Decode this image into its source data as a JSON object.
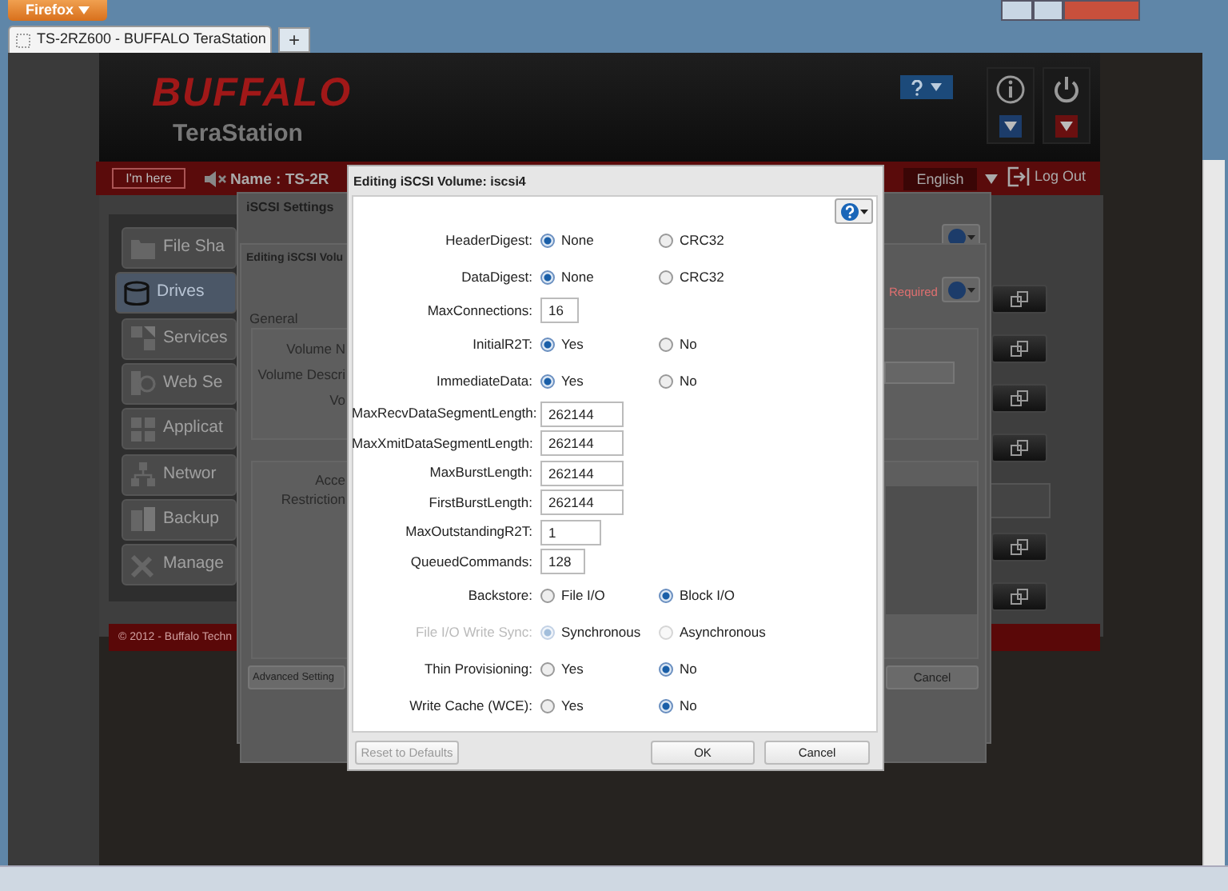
{
  "browser": {
    "menu_button": "Firefox",
    "tab_title": "TS-2RZ600 - BUFFALO TeraStation",
    "new_tab": "+"
  },
  "header": {
    "logo": "BUFFALO",
    "product": "TeraStation"
  },
  "toolbar": {
    "locate_button": "I'm here",
    "device_name": "Name : TS-2R",
    "language": "English",
    "logout": "Log Out"
  },
  "sidebar": {
    "items": [
      {
        "label": "File Sha",
        "selected": false
      },
      {
        "label": "Drives",
        "selected": true
      },
      {
        "label": "Services",
        "selected": false
      },
      {
        "label": "Web Se",
        "selected": false
      },
      {
        "label": "Applicat",
        "selected": false
      },
      {
        "label": "Networ",
        "selected": false
      },
      {
        "label": "Backup",
        "selected": false
      },
      {
        "label": "Manage",
        "selected": false
      }
    ]
  },
  "footer": "© 2012 - Buffalo Techn",
  "settings_dialog": {
    "title": "iSCSI Settings"
  },
  "volume_dialog": {
    "title": "Editing iSCSI Volu",
    "required": "Required",
    "section": "General",
    "general_labels": [
      "Volume N",
      "Volume Descri",
      "Vo"
    ],
    "access_labels": [
      "Acce",
      "Restriction"
    ],
    "advanced_button": "Advanced Setting",
    "cancel_button": "Cancel"
  },
  "edit_dialog": {
    "title": "Editing iSCSI Volume: iscsi4",
    "fields": [
      {
        "kind": "radio",
        "label": "HeaderDigest:",
        "disabled": false,
        "options": [
          {
            "label": "None",
            "selected": true
          },
          {
            "label": "CRC32",
            "selected": false
          }
        ]
      },
      {
        "kind": "radio",
        "label": "DataDigest:",
        "disabled": false,
        "options": [
          {
            "label": "None",
            "selected": true
          },
          {
            "label": "CRC32",
            "selected": false
          }
        ]
      },
      {
        "kind": "text",
        "label": "MaxConnections:",
        "value": "16"
      },
      {
        "kind": "radio",
        "label": "InitialR2T:",
        "disabled": false,
        "options": [
          {
            "label": "Yes",
            "selected": true
          },
          {
            "label": "No",
            "selected": false
          }
        ]
      },
      {
        "kind": "radio",
        "label": "ImmediateData:",
        "disabled": false,
        "options": [
          {
            "label": "Yes",
            "selected": true
          },
          {
            "label": "No",
            "selected": false
          }
        ]
      },
      {
        "kind": "text",
        "label": "MaxRecvDataSegmentLength:",
        "value": "262144"
      },
      {
        "kind": "text",
        "label": "MaxXmitDataSegmentLength:",
        "value": "262144"
      },
      {
        "kind": "text",
        "label": "MaxBurstLength:",
        "value": "262144"
      },
      {
        "kind": "text",
        "label": "FirstBurstLength:",
        "value": "262144"
      },
      {
        "kind": "text",
        "label": "MaxOutstandingR2T:",
        "value": "1"
      },
      {
        "kind": "text",
        "label": "QueuedCommands:",
        "value": "128"
      },
      {
        "kind": "radio",
        "label": "Backstore:",
        "disabled": false,
        "options": [
          {
            "label": "File I/O",
            "selected": false
          },
          {
            "label": "Block I/O",
            "selected": true
          }
        ]
      },
      {
        "kind": "radio",
        "label": "File I/O Write Sync:",
        "disabled": true,
        "options": [
          {
            "label": "Synchronous",
            "selected": true
          },
          {
            "label": "Asynchronous",
            "selected": false
          }
        ]
      },
      {
        "kind": "radio",
        "label": "Thin Provisioning:",
        "disabled": false,
        "options": [
          {
            "label": "Yes",
            "selected": false
          },
          {
            "label": "No",
            "selected": true
          }
        ]
      },
      {
        "kind": "radio",
        "label": "Write Cache (WCE):",
        "disabled": false,
        "options": [
          {
            "label": "Yes",
            "selected": false
          },
          {
            "label": "No",
            "selected": true
          }
        ]
      }
    ],
    "reset_button": {
      "label": "Reset to Defaults",
      "disabled": true
    },
    "ok_button": "OK",
    "cancel_button": "Cancel"
  }
}
